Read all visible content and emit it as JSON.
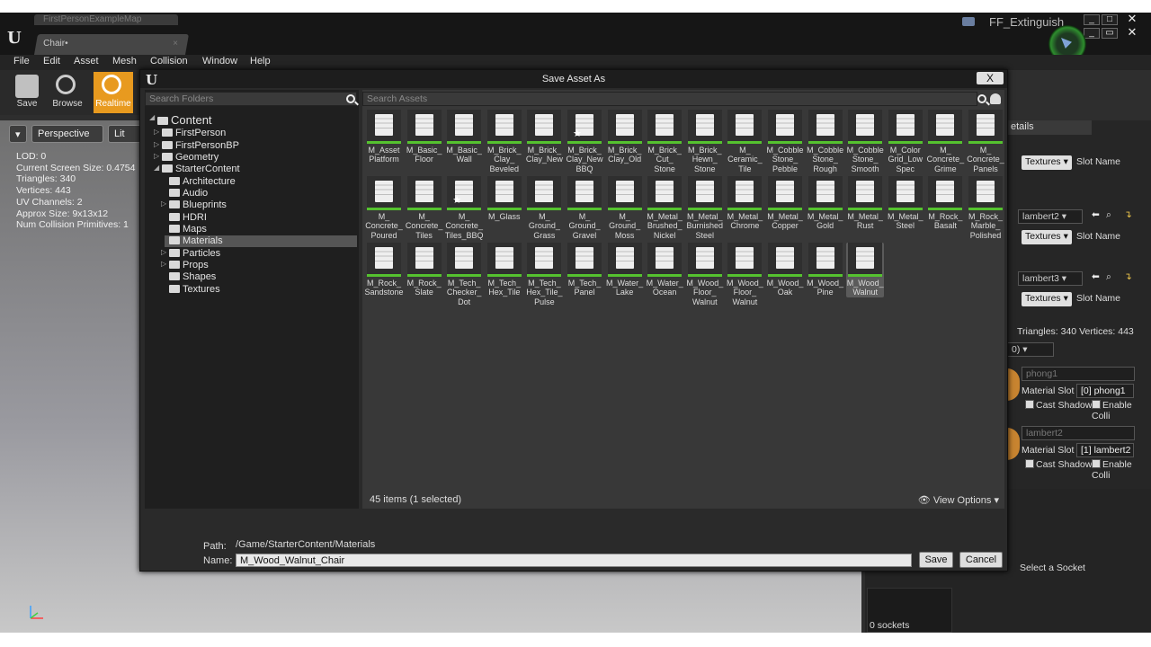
{
  "editor": {
    "map_tab": "FirstPersonExampleMap",
    "asset_tab": "Chair•",
    "project_name": "FF_Extinguish",
    "menu": [
      "File",
      "Edit",
      "Asset",
      "Mesh",
      "Collision",
      "Window",
      "Help"
    ],
    "toolbar": {
      "save": "Save",
      "browse": "Browse",
      "realtime": "Realtime"
    },
    "viewport": {
      "perspective": "Perspective",
      "lit": "Lit",
      "stats": [
        "LOD:  0",
        "Current Screen Size:  0.4754",
        "Triangles:  340",
        "Vertices:  443",
        "UV Channels:  2",
        "Approx Size: 9x13x12",
        "Num Collision Primitives:  1"
      ]
    },
    "details": {
      "tab_label": "etails",
      "textures_label": "Textures",
      "slot_name": "Slot Name",
      "lambert2": "lambert2",
      "lambert3": "lambert3",
      "tri_vert": "Triangles: 340   Vertices: 443",
      "lod_dd": "0)",
      "phong1": "phong1",
      "material_slot": "Material Slot",
      "slot0": "[0] phong1",
      "slot1": "[1] lambert2",
      "cast_shadow": "Cast Shadow",
      "enable_collision": "Enable Colli",
      "lambert2_b": "lambert2",
      "select_socket": "Select a Socket",
      "sockets": "0 sockets"
    }
  },
  "dialog": {
    "title": "Save Asset As",
    "close": "X",
    "search_folders_placeholder": "Search Folders",
    "search_assets_placeholder": "Search Assets",
    "tree": {
      "root": "Content",
      "first_person": "FirstPerson",
      "first_person_bp": "FirstPersonBP",
      "geometry": "Geometry",
      "starter_content": "StarterContent",
      "architecture": "Architecture",
      "audio": "Audio",
      "blueprints": "Blueprints",
      "hdri": "HDRI",
      "maps": "Maps",
      "materials": "Materials",
      "particles": "Particles",
      "props": "Props",
      "shapes": "Shapes",
      "textures": "Textures"
    },
    "assets": [
      "M_Asset\nPlatform",
      "M_Basic_\nFloor",
      "M_Basic_\nWall",
      "M_Brick_\nClay_\nBeveled",
      "M_Brick_\nClay_New",
      "M_Brick_\nClay_New\nBBQ",
      "M_Brick_\nClay_Old",
      "M_Brick_\nCut_\nStone",
      "M_Brick_\nHewn_\nStone",
      "M_\nCeramic_\nTile",
      "M_Cobble\nStone_\nPebble",
      "M_Cobble\nStone_\nRough",
      "M_Cobble\nStone_\nSmooth",
      "M_Color\nGrid_Low\nSpec",
      "M_\nConcrete_\nGrime",
      "M_\nConcrete_\nPanels",
      "M_\nConcrete_\nPoured",
      "M_\nConcrete_\nTiles",
      "M_\nConcrete_\nTiles_BBQ",
      "M_Glass",
      "M_\nGround_\nGrass",
      "M_\nGround_\nGravel",
      "M_\nGround_\nMoss",
      "M_Metal_\nBrushed_\nNickel",
      "M_Metal_\nBurnished\nSteel",
      "M_Metal_\nChrome",
      "M_Metal_\nCopper",
      "M_Metal_\nGold",
      "M_Metal_\nRust",
      "M_Metal_\nSteel",
      "M_Rock_\nBasalt",
      "M_Rock_\nMarble_\nPolished",
      "M_Rock_\nSandstone",
      "M_Rock_\nSlate",
      "M_Tech_\nChecker_\nDot",
      "M_Tech_\nHex_Tile",
      "M_Tech_\nHex_Tile_\nPulse",
      "M_Tech_\nPanel",
      "M_Water_\nLake",
      "M_Water_\nOcean",
      "M_Wood_\nFloor_\nWalnut",
      "M_Wood_\nFloor_\nWalnut",
      "M_Wood_\nOak",
      "M_Wood_\nPine",
      "M_Wood_\nWalnut"
    ],
    "starred": [
      5,
      18
    ],
    "selected_index": 44,
    "status": "45 items (1 selected)",
    "view_options": "View Options",
    "path_label": "Path:",
    "path_value": "/Game/StarterContent/Materials",
    "name_label": "Name:",
    "name_value": "M_Wood_Walnut_Chair",
    "save": "Save",
    "cancel": "Cancel"
  },
  "colors": {
    "accent_green": "#55c22f",
    "realtime_orange": "#e89a1f"
  }
}
